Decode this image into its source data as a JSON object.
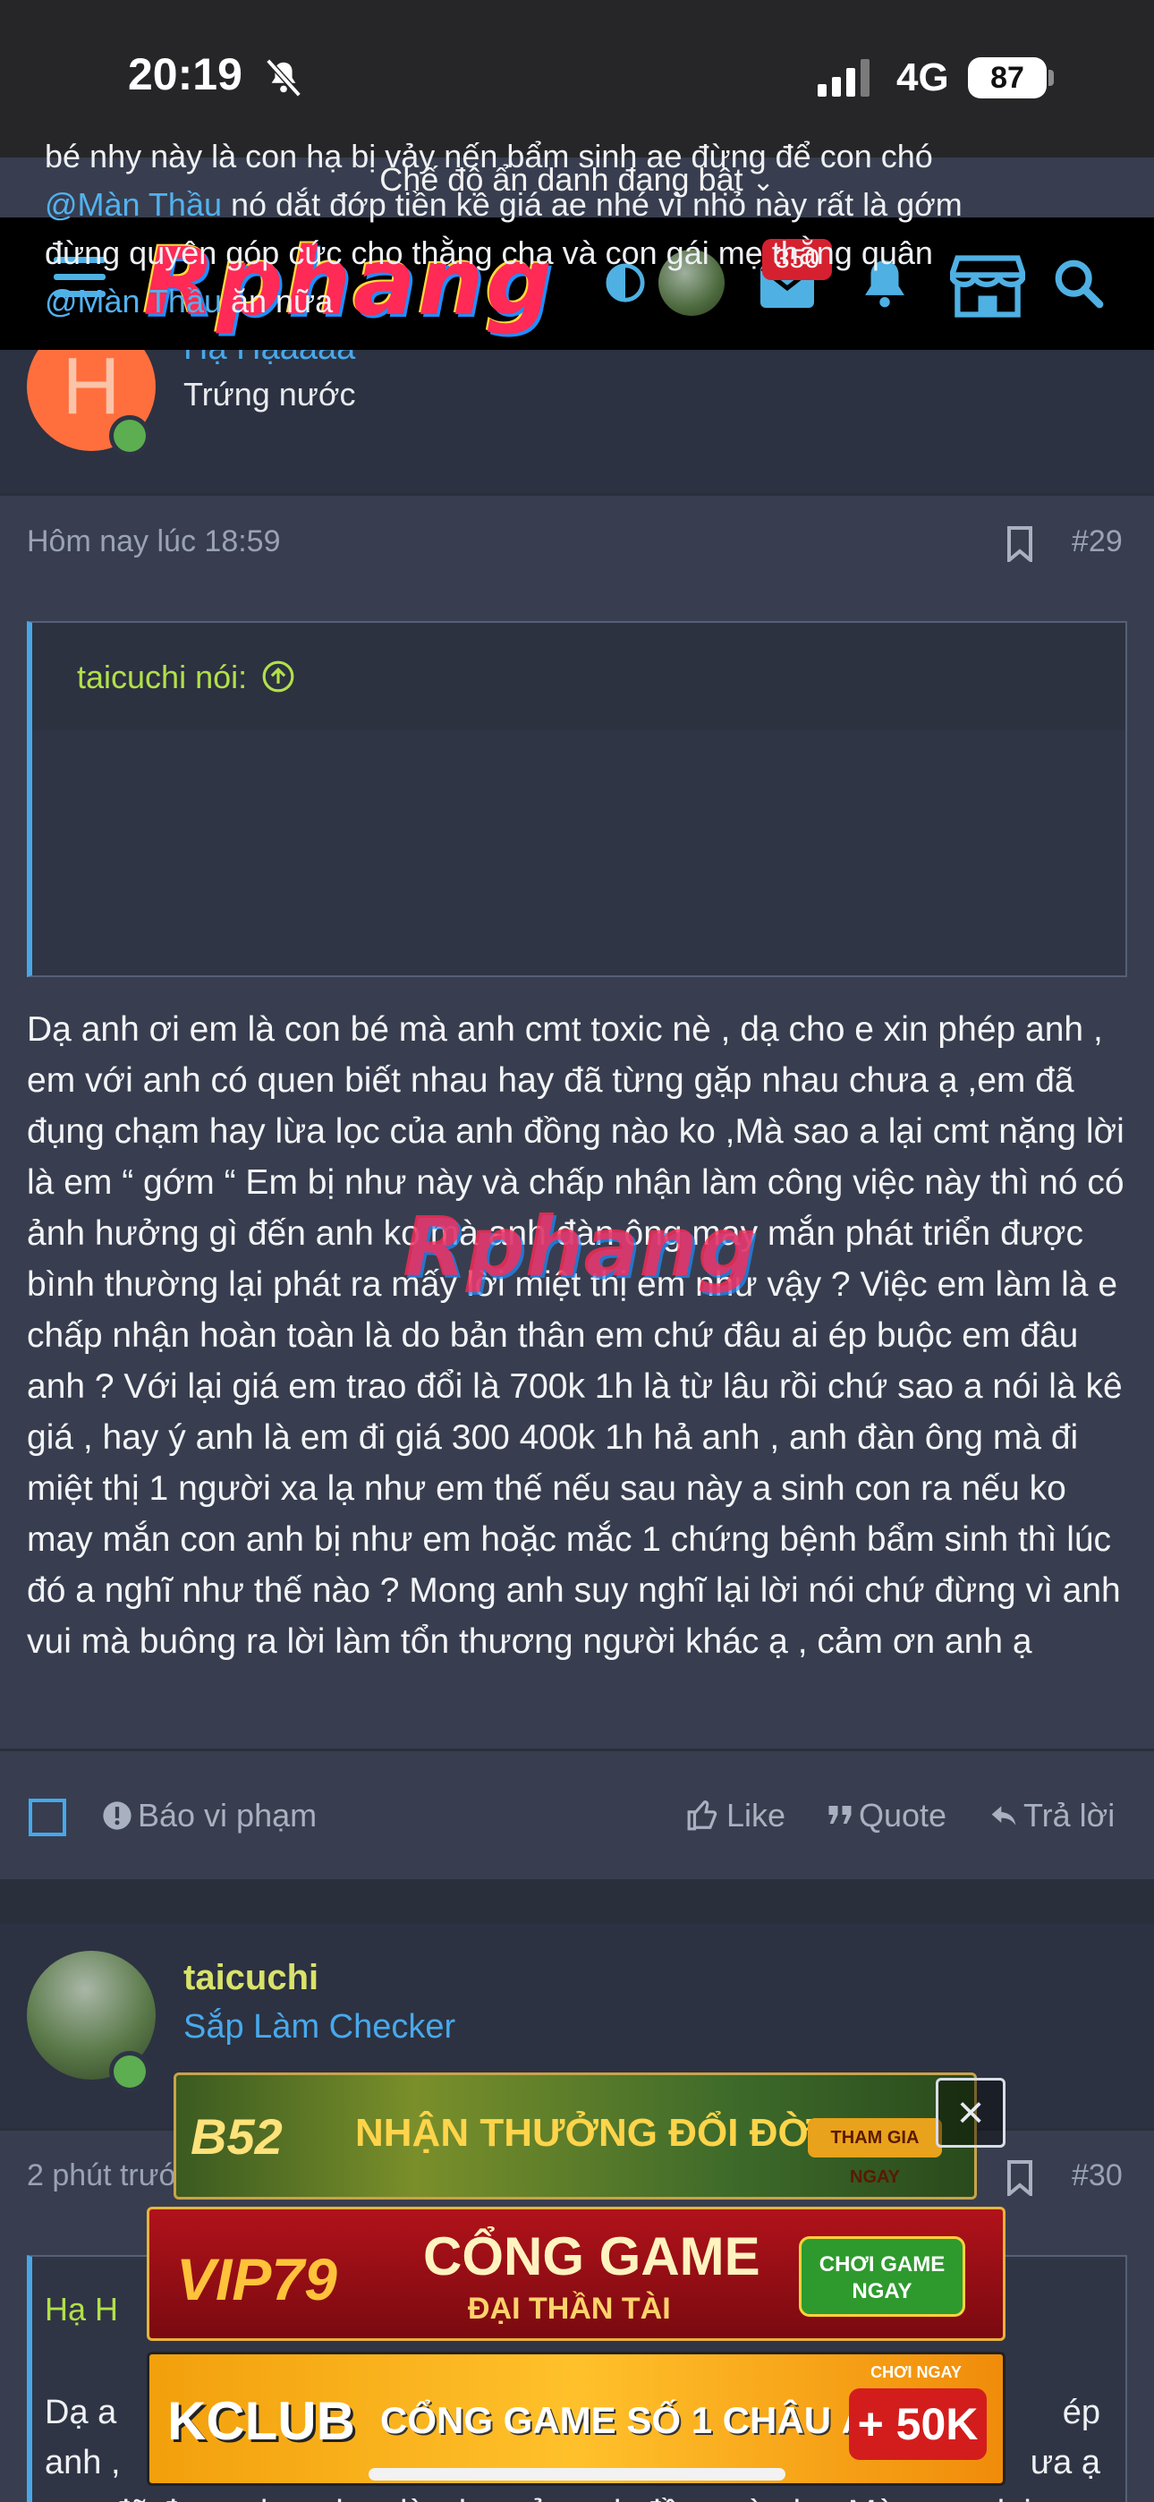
{
  "status_bar": {
    "time": "20:19",
    "network": "4G",
    "battery": "87"
  },
  "incognito_banner": "Chế độ ẩn danh đang bật",
  "nav": {
    "logo": "Rphang",
    "mail_badge": "350"
  },
  "post_1": {
    "author_name": "Hạ Hạaaaa",
    "author_title": "Trứng nước",
    "timestamp": "Hôm nay lúc 18:59",
    "number": "#29",
    "quote": {
      "author": "taicuchi nói:",
      "line1": "bé nhy này là con hạ bị vảy nến bẩm sinh ae đừng để con chó",
      "mention1": "@Màn Thầu",
      "line2": " nó dắt đớp tiền kê giá ae nhé vì nhỏ này rất là gớm",
      "line3": "đừng quyên góp cức cho thằng cha và con gái mẹ thằng quân",
      "mention2": "@Màn Thầu",
      "line4": " ăn nữa"
    },
    "body": "Dạ anh ơi em là con bé mà anh cmt toxic nè , dạ cho e xin phép anh , em với anh có quen biết nhau hay đã từng gặp nhau chưa ạ ,em đã đụng chạm hay lừa lọc của anh đồng nào ko ,Mà sao a lại cmt nặng lời là em “ gớm “ Em bị như này và chấp nhận làm công việc này thì nó có ảnh hưởng gì đến anh ko mà anh đàn ông may mắn phát triển được bình thường lại phát ra mấy lời miệt thị em như vậy ? Việc em làm là e chấp nhận hoàn toàn là do bản thân em chứ đâu ai ép buộc em đâu anh ? Với lại giá em trao đổi là 700k 1h là từ lâu rồi chứ sao a nói là kê giá , hay ý anh là em đi giá 300 400k 1h hả anh , anh đàn ông mà đi miệt thị 1 người xa lạ như em thế nếu sau này a sinh con ra nếu ko may mắn con anh bị như em hoặc mắc 1 chứng bệnh bẩm sinh thì lúc đó a nghĩ như thế nào ? Mong anh suy nghĩ lại lời nói chứ đừng vì anh vui mà buông ra lời làm tổn thương người khác ạ , cảm ơn anh ạ",
    "watermark": "Rphang",
    "actions": {
      "report": "Báo vi phạm",
      "like": "Like",
      "quote": "Quote",
      "reply": "Trả lời"
    }
  },
  "post_2": {
    "author_name": "taicuchi",
    "author_title": "Sắp Làm Checker",
    "timestamp": "2 phút trước",
    "number": "#30",
    "quote_author": "Hạ H",
    "body_line1": "Dạ a",
    "body_line1_end": "ép",
    "body_line2": "anh ,",
    "body_line2_end": "ưa ạ",
    "body_line3": ",em đã đụng chạm hay lừa lọc của anh đồng nào ko ,Mà sao a lại"
  },
  "ads": {
    "ad1_brand": "B52",
    "ad1_text": "NHẬN THƯỞNG ĐỔI ĐỜI",
    "ad1_cta": "THAM GIA NGAY",
    "ad2_brand": "VIP79",
    "ad2_line1": "CỔNG GAME",
    "ad2_line2": "ĐẠI THẦN TÀI",
    "ad2_cta": "CHƠI GAME NGAY",
    "ad3_brand": "KCLUB",
    "ad3_text": "CỔNG GAME SỐ 1 CHÂU Á",
    "ad3_cta_top": "CHƠI NGAY",
    "ad3_cta": "+ 50K",
    "close": "×"
  },
  "colors": {
    "accent_blue": "#48a9ec",
    "quote_green": "#b2e04a",
    "badge_red": "#d5202f",
    "page_bg": "#383e4f"
  }
}
